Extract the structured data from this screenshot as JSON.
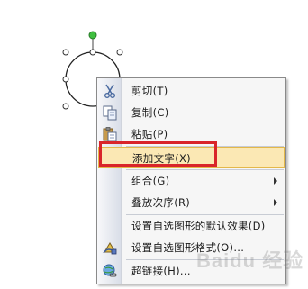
{
  "menu": {
    "items": [
      {
        "label": "剪切(T)",
        "icon": "scissors-icon"
      },
      {
        "label": "复制(C)",
        "icon": "copy-icon"
      },
      {
        "label": "粘贴(P)",
        "icon": "paste-icon"
      },
      {
        "label": "添加文字(X)",
        "icon": ""
      },
      {
        "label": "组合(G)",
        "icon": "",
        "submenu": true
      },
      {
        "label": "叠放次序(R)",
        "icon": "",
        "submenu": true
      },
      {
        "label": "设置自选图形的默认效果(D)",
        "icon": ""
      },
      {
        "label": "设置自选图形格式(O)...",
        "icon": "format-shape-icon"
      },
      {
        "label": "超链接(H)...",
        "icon": "hyperlink-icon"
      }
    ]
  },
  "watermark": "Baidu 经验",
  "colors": {
    "highlight_border": "#d9252a",
    "hover_fill": "#fbe8b4",
    "rotation_handle": "#3fbf3f"
  }
}
